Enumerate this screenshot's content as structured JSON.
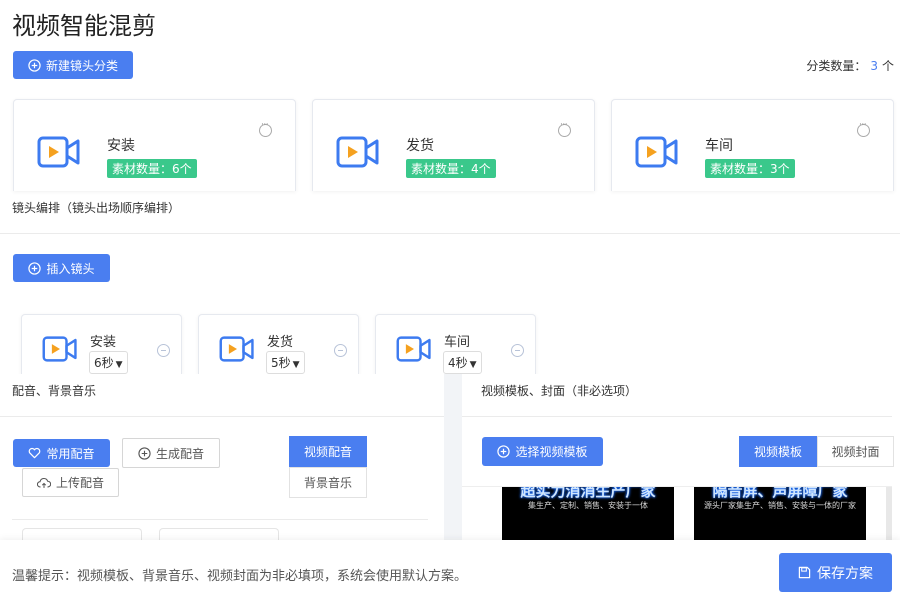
{
  "page": {
    "title": "视频智能混剪"
  },
  "categories": {
    "new_button": "新建镜头分类",
    "count_label": "分类数量：",
    "count_value": "3",
    "count_unit": "个",
    "items": [
      {
        "name": "安装",
        "badge": "素材数量：6个"
      },
      {
        "name": "发货",
        "badge": "素材数量：4个"
      },
      {
        "name": "车间",
        "badge": "素材数量：3个"
      }
    ]
  },
  "arrangement": {
    "label": "镜头编排（镜头出场顺序编排）",
    "insert_button": "插入镜头",
    "shots": [
      {
        "name": "安装",
        "duration": "6秒"
      },
      {
        "name": "发货",
        "duration": "5秒"
      },
      {
        "name": "车间",
        "duration": "4秒"
      }
    ]
  },
  "audio": {
    "label": "配音、背景音乐",
    "common_voice_button": "常用配音",
    "generate_voice_button": "生成配音",
    "upload_voice_button": "上传配音",
    "tabs": [
      "视频配音",
      "背景音乐"
    ]
  },
  "template": {
    "label": "视频模板、封面（非必选项）",
    "select_button": "选择视频模板",
    "tabs": [
      "视频模板",
      "视频封面"
    ],
    "thumbs": [
      {
        "headline": "超实力消消生产厂家",
        "subline": "集生产、定制、销售、安装于一体"
      },
      {
        "headline": "隔音屏、声屏障厂家",
        "subline": "源头厂家集生产、销售、安装与一体的厂家"
      }
    ]
  },
  "footer": {
    "hint": "温馨提示：视频模板、背景音乐、视频封面为非必填项，系统会使用默认方案。",
    "save_button": "保存方案"
  },
  "colors": {
    "primary": "#4a7ef0",
    "badge": "#3ac88b",
    "camera_icon": "#3d7bf0",
    "play": "#f5a11f"
  }
}
